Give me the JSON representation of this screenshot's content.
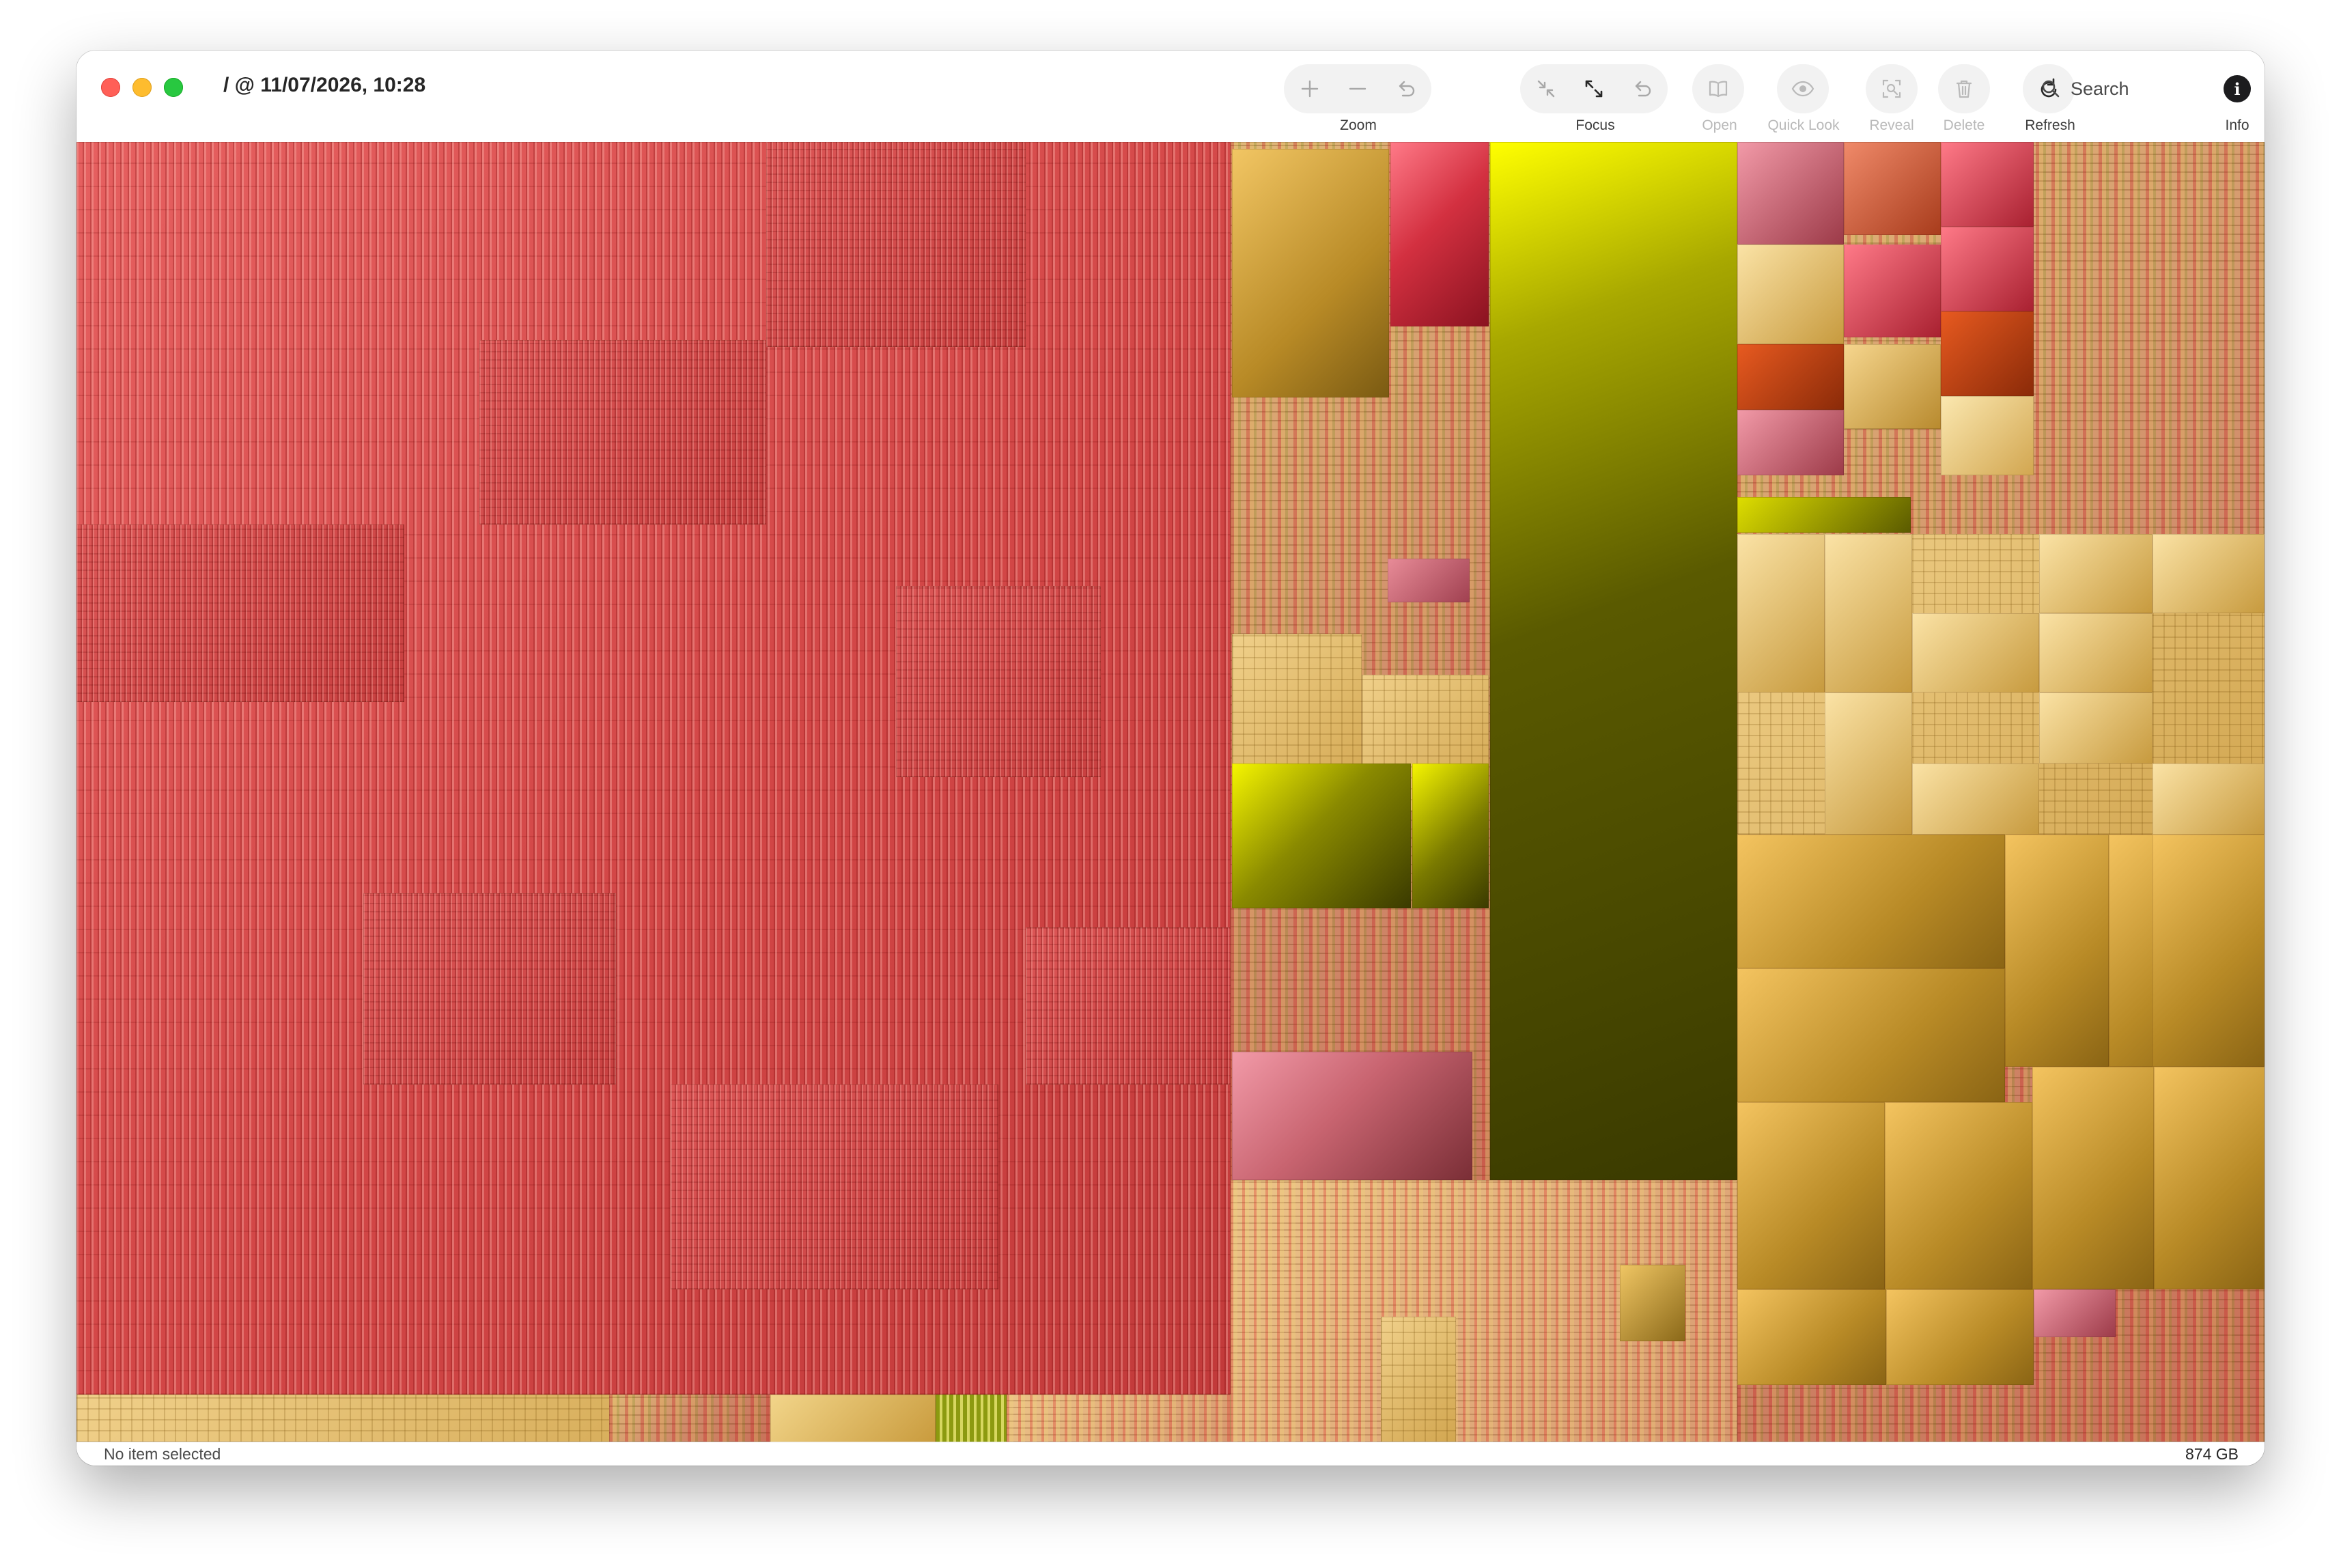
{
  "window": {
    "title": "/ @ 11/07/2026, 10:28"
  },
  "toolbar": {
    "zoom_label": "Zoom",
    "focus_label": "Focus",
    "open_label": "Open",
    "quicklook_label": "Quick Look",
    "reveal_label": "Reveal",
    "delete_label": "Delete",
    "refresh_label": "Refresh",
    "info_label": "Info",
    "search_placeholder": "Search"
  },
  "status": {
    "selection": "No item selected",
    "total_size": "874 GB"
  },
  "colors": {
    "red": "#d24646",
    "gold": "#c8962c",
    "olive": "#5a5a00",
    "yellow": "#e8e800",
    "rose": "#c86470",
    "orange": "#c83c14"
  },
  "icons": [
    "plus-icon",
    "minus-icon",
    "undo-icon",
    "collapse-icon",
    "expand-icon",
    "book-icon",
    "eye-icon",
    "reveal-icon",
    "trash-icon",
    "refresh-icon",
    "magnifier-icon",
    "info-icon"
  ]
}
